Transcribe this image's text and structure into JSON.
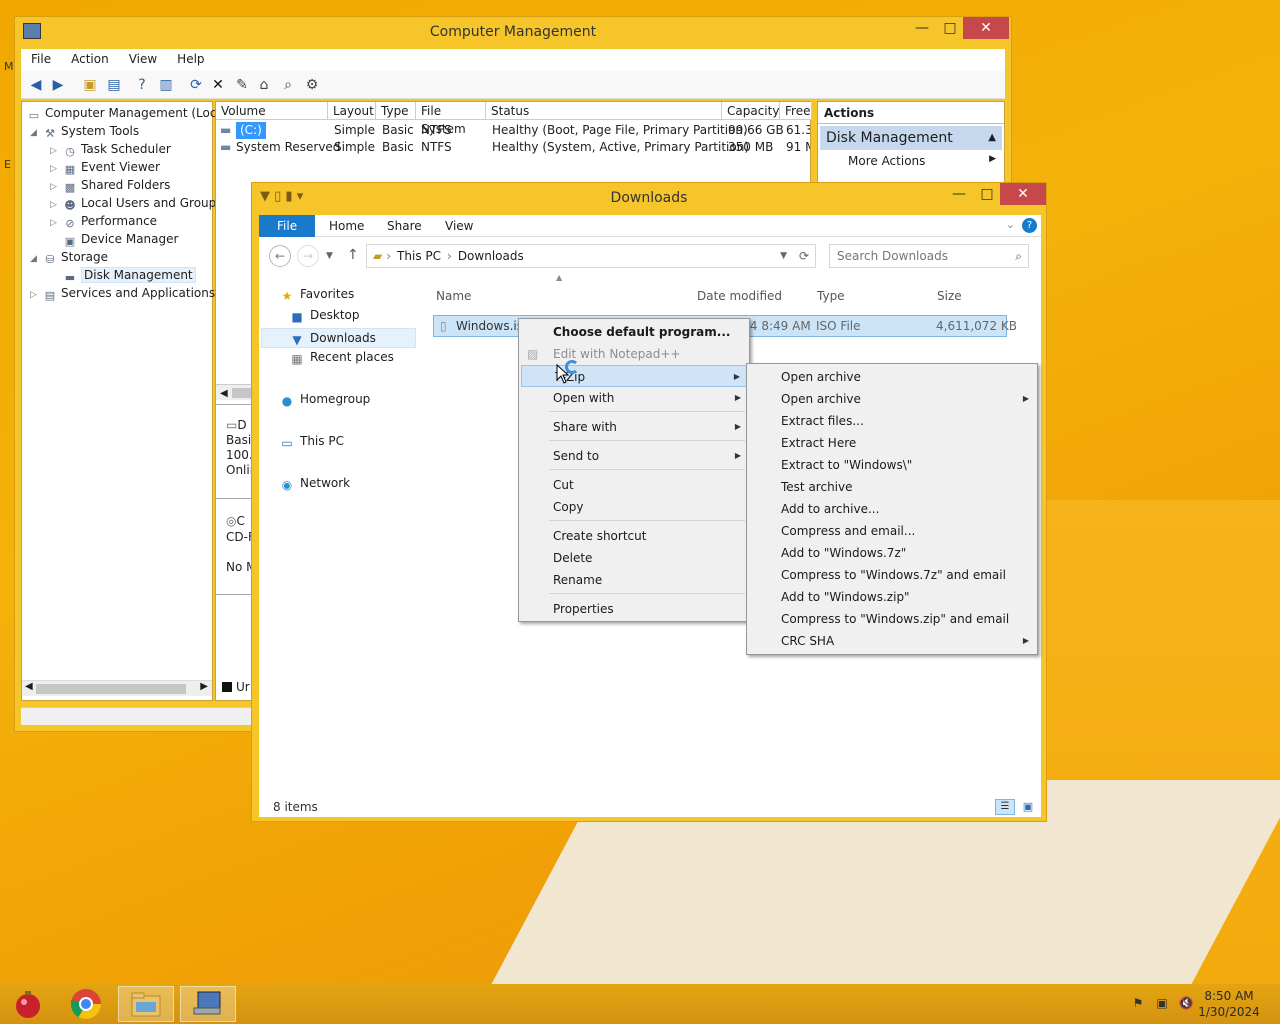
{
  "desktop": {
    "left_labels": [
      "M",
      "E"
    ]
  },
  "computer_management": {
    "title": "Computer Management",
    "menu": [
      "File",
      "Action",
      "View",
      "Help"
    ],
    "tree": [
      {
        "label": "Computer Management (Local",
        "level": 0
      },
      {
        "label": "System Tools",
        "level": 1
      },
      {
        "label": "Task Scheduler",
        "level": 2
      },
      {
        "label": "Event Viewer",
        "level": 2
      },
      {
        "label": "Shared Folders",
        "level": 2
      },
      {
        "label": "Local Users and Groups",
        "level": 2
      },
      {
        "label": "Performance",
        "level": 2
      },
      {
        "label": "Device Manager",
        "level": 2
      },
      {
        "label": "Storage",
        "level": 1
      },
      {
        "label": "Disk Management",
        "level": 2
      },
      {
        "label": "Services and Applications",
        "level": 1
      }
    ],
    "columns": [
      "Volume",
      "Layout",
      "Type",
      "File System",
      "Status",
      "Capacity",
      "Free"
    ],
    "volumes": [
      {
        "volume": "(C:)",
        "layout": "Simple",
        "type": "Basic",
        "fs": "NTFS",
        "status": "Healthy (Boot, Page File, Primary Partition)",
        "capacity": "99.66 GB",
        "free": "61.3"
      },
      {
        "volume": "System Reserved",
        "layout": "Simple",
        "type": "Basic",
        "fs": "NTFS",
        "status": "Healthy (System, Active, Primary Partition)",
        "capacity": "350 MB",
        "free": "91 M"
      }
    ],
    "disk_panel": {
      "disk0": [
        "D",
        "Basic",
        "100.",
        "Onlin"
      ],
      "cdrom": [
        "C",
        "CD-F",
        "",
        "No M"
      ],
      "legend": "Ur"
    },
    "actions": {
      "header": "Actions",
      "group": "Disk Management",
      "more": "More Actions"
    }
  },
  "explorer": {
    "title": "Downloads",
    "ribbon_tabs": [
      "File",
      "Home",
      "Share",
      "View"
    ],
    "breadcrumb": [
      "This PC",
      "Downloads"
    ],
    "search_placeholder": "Search Downloads",
    "nav": {
      "favorites": "Favorites",
      "desktop": "Desktop",
      "downloads": "Downloads",
      "recent": "Recent places",
      "homegroup": "Homegroup",
      "thispc": "This PC",
      "network": "Network"
    },
    "columns": [
      "Name",
      "Date modified",
      "Type",
      "Size"
    ],
    "file": {
      "name": "Windows.iso",
      "date": "1/30/2024 8:49 AM",
      "type": "ISO File",
      "size": "4,611,072 KB"
    },
    "status": "8 items"
  },
  "context_menu": {
    "items": [
      "Choose default program...",
      "Edit with Notepad++",
      "7-Zip",
      "Open with",
      "Share with",
      "Send to",
      "Cut",
      "Copy",
      "Create shortcut",
      "Delete",
      "Rename",
      "Properties"
    ],
    "visible_7zip_label": "7-Zip"
  },
  "submenu_7zip": {
    "items": [
      "Open archive",
      "Open archive",
      "Extract files...",
      "Extract Here",
      "Extract to \"Windows\\\"",
      "Test archive",
      "Add to archive...",
      "Compress and email...",
      "Add to \"Windows.7z\"",
      "Compress to \"Windows.7z\" and email",
      "Add to \"Windows.zip\"",
      "Compress to \"Windows.zip\" and email",
      "CRC SHA"
    ]
  },
  "taskbar": {
    "time": "8:50 AM",
    "date": "1/30/2024"
  },
  "colors": {
    "accent": "#1979ca",
    "close": "#c7484b",
    "selection": "#cce4f7",
    "desktop": "#f0a800"
  }
}
